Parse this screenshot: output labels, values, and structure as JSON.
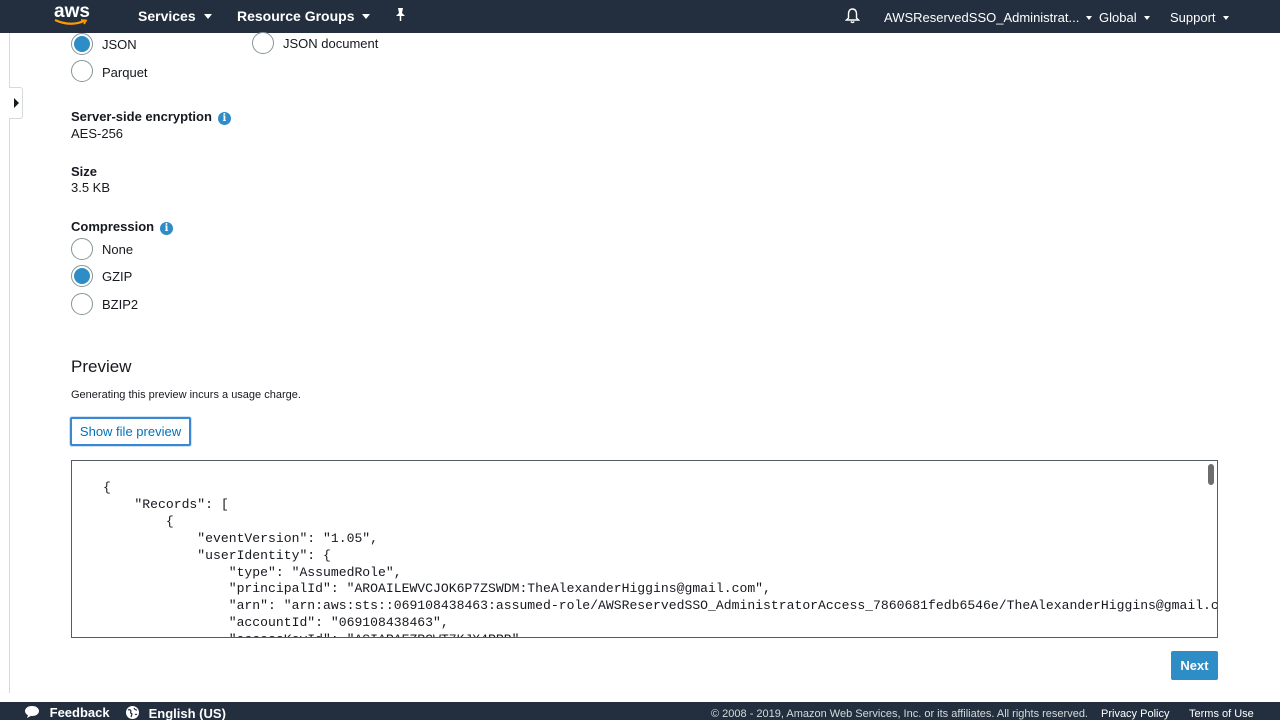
{
  "nav": {
    "logo": "aws",
    "services": "Services",
    "resource_groups": "Resource Groups",
    "account": "AWSReservedSSO_Administrat...",
    "region": "Global",
    "support": "Support"
  },
  "format": {
    "options": [
      {
        "label": "JSON",
        "checked": true
      },
      {
        "label": "Parquet",
        "checked": false
      },
      {
        "label": "JSON document",
        "checked": false
      }
    ]
  },
  "encryption": {
    "label": "Server-side encryption",
    "value": "AES-256"
  },
  "size": {
    "label": "Size",
    "value": "3.5 KB"
  },
  "compression": {
    "label": "Compression",
    "options": [
      {
        "label": "None",
        "checked": false
      },
      {
        "label": "GZIP",
        "checked": true
      },
      {
        "label": "BZIP2",
        "checked": false
      }
    ]
  },
  "preview": {
    "heading": "Preview",
    "note": "Generating this preview incurs a usage charge.",
    "button": "Show file preview",
    "content": "{\n    \"Records\": [\n        {\n            \"eventVersion\": \"1.05\",\n            \"userIdentity\": {\n                \"type\": \"AssumedRole\",\n                \"principalId\": \"AROAILEWVCJOK6P7ZSWDM:TheAlexanderHiggins@gmail.com\",\n                \"arn\": \"arn:aws:sts::069108438463:assumed-role/AWSReservedSSO_AdministratorAccess_7860681fedb6546e/TheAlexanderHiggins@gmail.com\",\n                \"accountId\": \"069108438463\",\n                \"accessKeyId\": \"ASIARAEZRCWT7KJX4RRB\","
  },
  "next_button": "Next",
  "footer": {
    "feedback": "Feedback",
    "language": "English (US)",
    "copyright": "© 2008 - 2019, Amazon Web Services, Inc. or its affiliates. All rights reserved.",
    "privacy": "Privacy Policy",
    "terms": "Terms of Use"
  },
  "colors": {
    "nav_bg": "#232f3e",
    "accent": "#2e8cc6",
    "link": "#0073bb"
  }
}
